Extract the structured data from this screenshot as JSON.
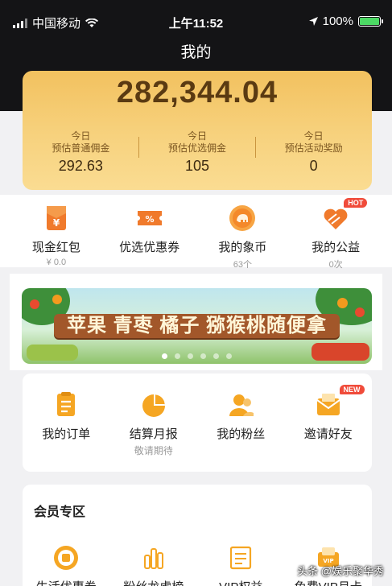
{
  "status_bar": {
    "carrier": "中国移动",
    "time": "上午11:52",
    "battery": "100%"
  },
  "header": {
    "title": "我的"
  },
  "earnings": {
    "total": "282,344.04",
    "stats": [
      {
        "line1": "今日",
        "line2": "预估普通佣金",
        "value": "292.63"
      },
      {
        "line1": "今日",
        "line2": "预估优选佣金",
        "value": "105"
      },
      {
        "line1": "今日",
        "line2": "预估活动奖励",
        "value": "0"
      }
    ]
  },
  "quick_items": [
    {
      "label": "现金红包",
      "sub": "¥ 0.0",
      "icon": "red-envelope-icon"
    },
    {
      "label": "优选优惠券",
      "sub": "",
      "icon": "coupon-icon"
    },
    {
      "label": "我的象币",
      "sub": "63个",
      "icon": "elephant-coin-icon"
    },
    {
      "label": "我的公益",
      "sub": "0次",
      "icon": "charity-heart-icon",
      "badge": "HOT"
    }
  ],
  "banner": {
    "text": "苹果 青枣 橘子 猕猴桃随便拿",
    "dot_count": 6,
    "active_dot": 0
  },
  "orders_grid": [
    {
      "label": "我的订单",
      "sub": "",
      "icon": "order-list-icon"
    },
    {
      "label": "结算月报",
      "sub": "敬请期待",
      "icon": "pie-chart-icon"
    },
    {
      "label": "我的粉丝",
      "sub": "",
      "icon": "fans-icon"
    },
    {
      "label": "邀请好友",
      "sub": "",
      "icon": "invite-envelope-icon",
      "badge": "NEW"
    }
  ],
  "member": {
    "title": "会员专区",
    "items": [
      {
        "label": "生活优惠券",
        "icon": "life-coupon-icon"
      },
      {
        "label": "粉丝龙虎榜",
        "icon": "ranking-bars-icon"
      },
      {
        "label": "VIP权益",
        "icon": "vip-rights-icon"
      },
      {
        "label": "免费VIP月卡",
        "icon": "vip-card-icon"
      }
    ]
  },
  "watermark": "头条 @娱乐聚华秀",
  "colors": {
    "accent_gold": "#f2c15f",
    "icon_orange": "#f5a623",
    "badge_red": "#f04b3a"
  }
}
